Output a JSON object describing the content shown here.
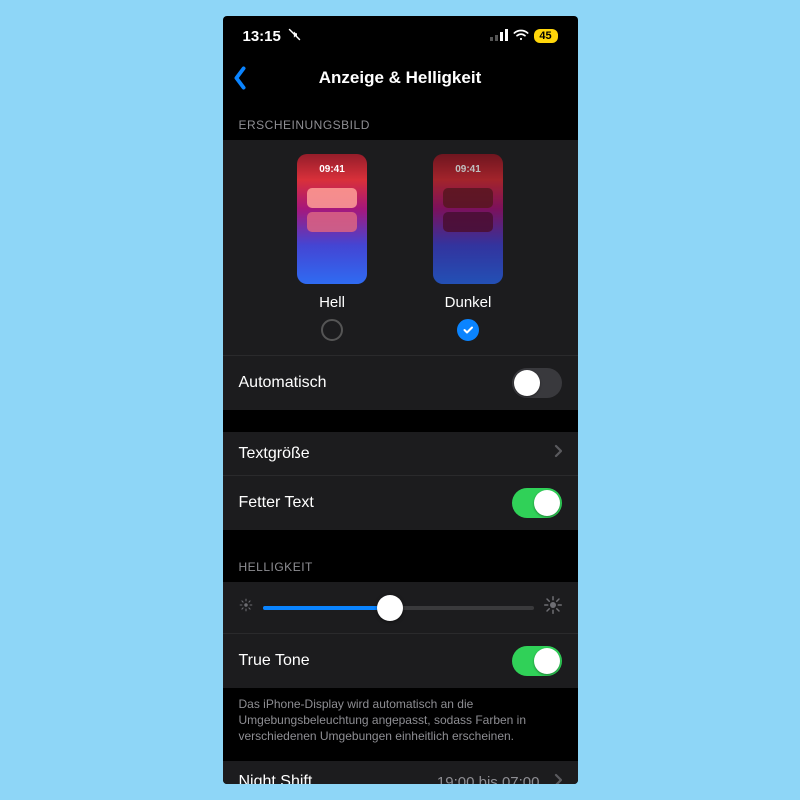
{
  "statusbar": {
    "time": "13:15",
    "battery": "45"
  },
  "nav": {
    "title": "Anzeige & Helligkeit"
  },
  "sections": {
    "appearance": {
      "header": "ERSCHEINUNGSBILD",
      "options": {
        "light": {
          "label": "Hell",
          "thumb_time": "09:41"
        },
        "dark": {
          "label": "Dunkel",
          "thumb_time": "09:41",
          "selected": true
        }
      },
      "automatic": {
        "label": "Automatisch",
        "on": false
      }
    },
    "text": {
      "size": {
        "label": "Textgröße"
      },
      "bold": {
        "label": "Fetter Text",
        "on": true
      }
    },
    "brightness": {
      "header": "HELLIGKEIT",
      "slider_percent": 47,
      "true_tone": {
        "label": "True Tone",
        "on": true
      },
      "footer": "Das iPhone-Display wird automatisch an die Umgebungsbeleuchtung angepasst, sodass Farben in verschiedenen Umgebungen einheitlich erscheinen."
    },
    "night_shift": {
      "label": "Night Shift",
      "value": "19:00 bis 07:00"
    }
  }
}
